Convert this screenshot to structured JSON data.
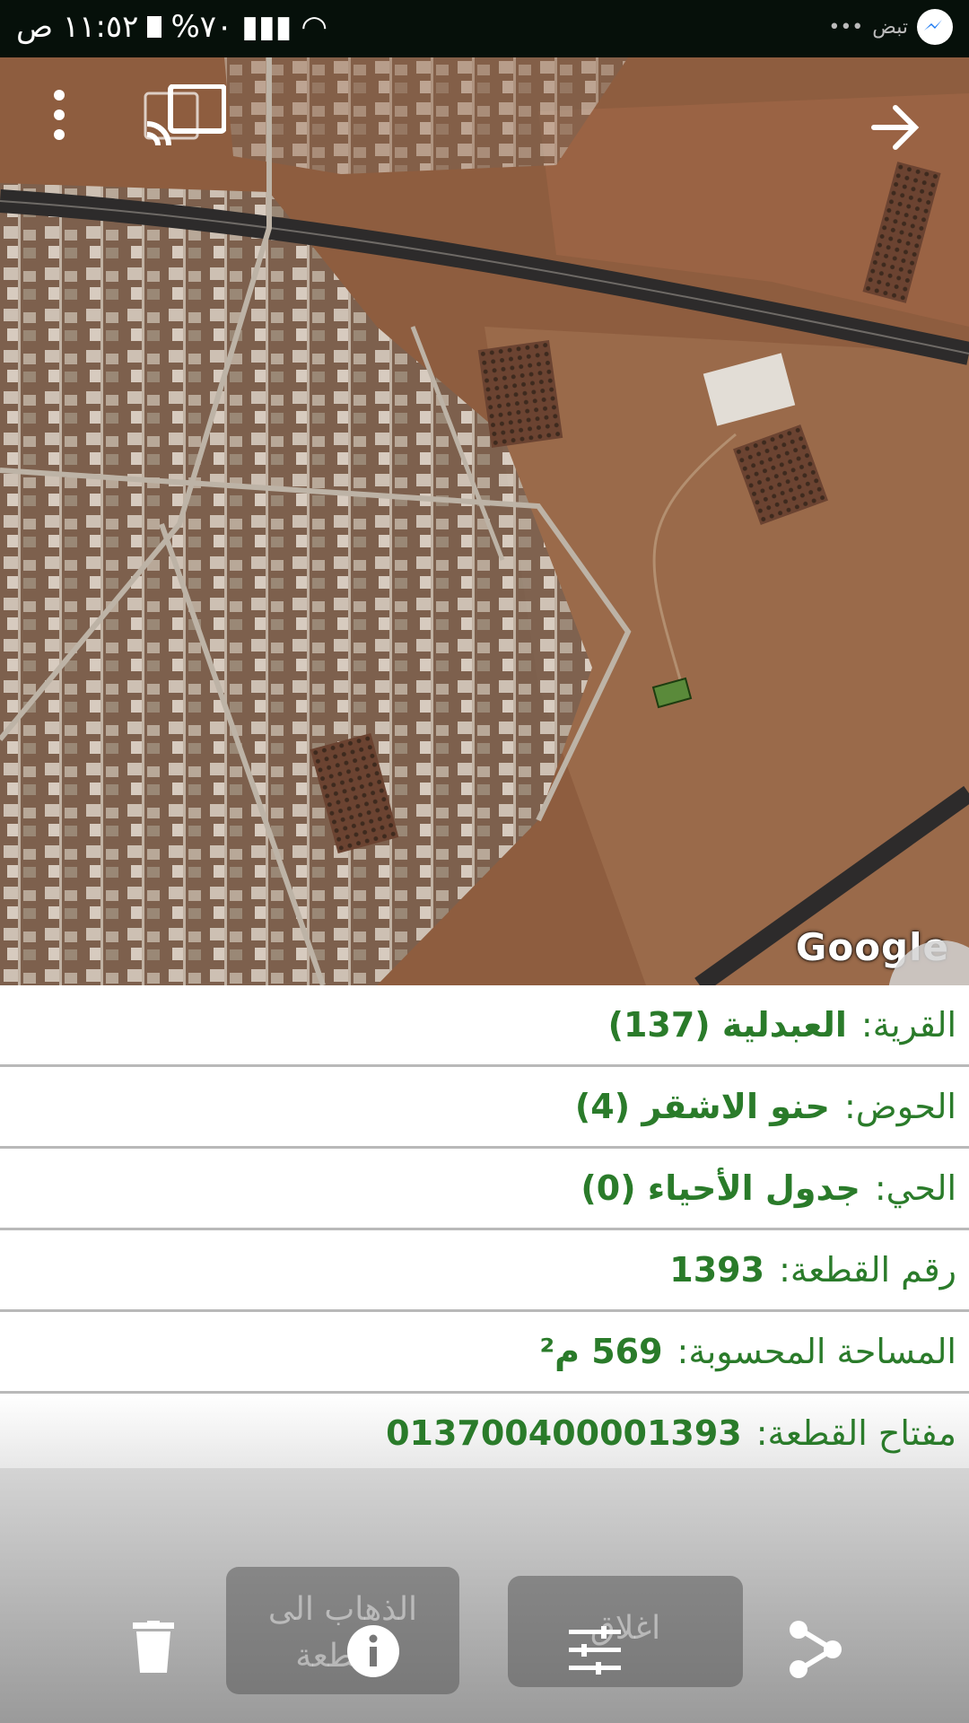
{
  "status_bar": {
    "time": "١١:٥٢ ص",
    "battery": "%٧٠",
    "notification": "تبض"
  },
  "map": {
    "attribution": "Google",
    "icons": {
      "menu": "more-vert-icon",
      "cast": "cast-icon",
      "forward": "arrow-forward-icon"
    }
  },
  "parcel": {
    "village_label": "القرية:",
    "village_value": "العبدلية (137)",
    "basin_label": "الحوض:",
    "basin_value": "حنو الاشقر (4)",
    "district_label": "الحي:",
    "district_value": "جدول الأحياء (0)",
    "parcel_no_label": "رقم القطعة:",
    "parcel_no_value": "1393",
    "area_label": "المساحة المحسوبة:",
    "area_value": "569 م²",
    "key_label": "مفتاح القطعة:",
    "key_value": "013700400001393"
  },
  "toolbar": {
    "goto_label": "الذهاب الى القطعة",
    "close_label": "اغلاق",
    "icons": [
      "delete-icon",
      "info-icon",
      "filter-icon",
      "share-icon"
    ]
  }
}
